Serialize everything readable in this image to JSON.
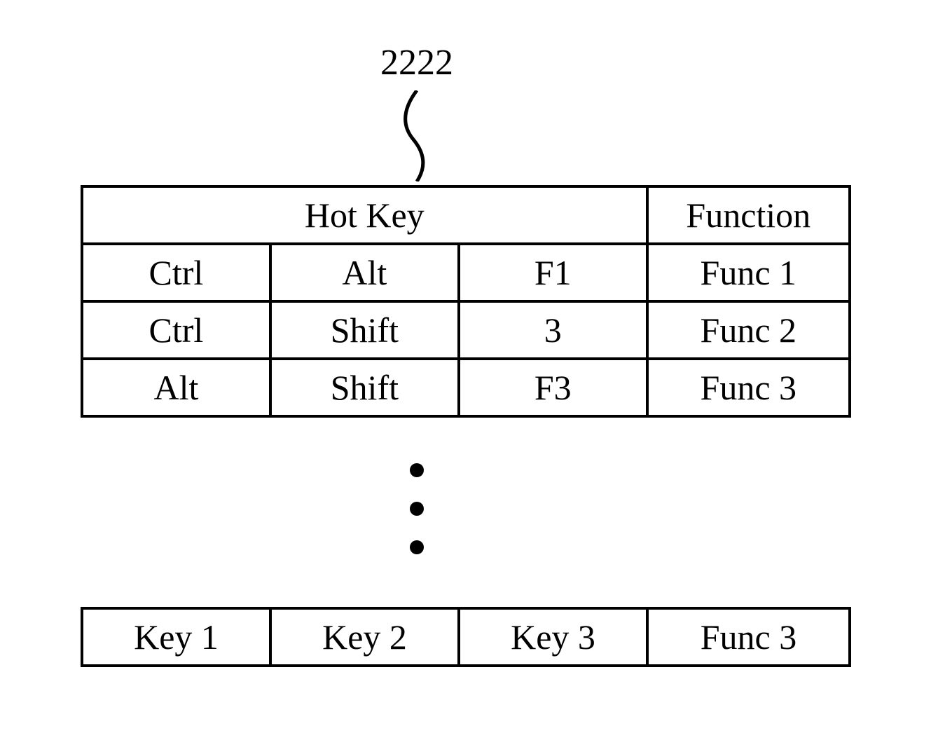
{
  "reference_number": "2222",
  "table": {
    "headers": {
      "hot_key": "Hot Key",
      "function": "Function"
    },
    "rows": [
      {
        "key1": "Ctrl",
        "key2": "Alt",
        "key3": "F1",
        "func": "Func 1"
      },
      {
        "key1": "Ctrl",
        "key2": "Shift",
        "key3": "3",
        "func": "Func 2"
      },
      {
        "key1": "Alt",
        "key2": "Shift",
        "key3": "F3",
        "func": "Func 3"
      }
    ],
    "bottom_row": {
      "key1": "Key 1",
      "key2": "Key 2",
      "key3": "Key 3",
      "func": "Func 3"
    }
  }
}
